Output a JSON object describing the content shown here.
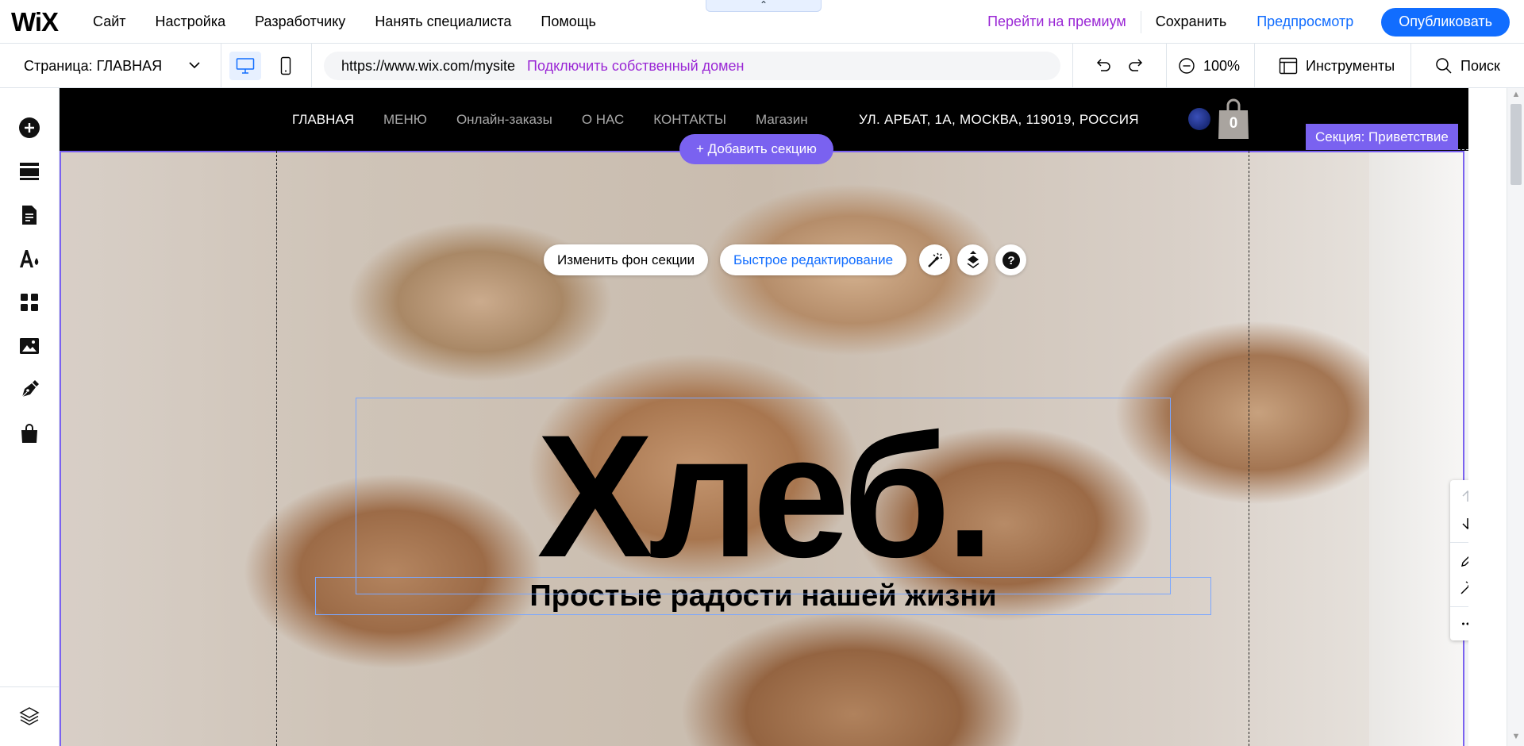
{
  "app": {
    "logo": "WiX",
    "menu": [
      "Сайт",
      "Настройка",
      "Разработчику",
      "Нанять специалиста",
      "Помощь"
    ],
    "collapse_icon": "caret-up-icon",
    "premium": "Перейти на премиум",
    "save": "Сохранить",
    "preview": "Предпросмотр",
    "publish": "Опубликовать"
  },
  "toolbar": {
    "page_selector": "Страница: ГЛАВНАЯ",
    "url": "https://www.wix.com/mysite",
    "connect_domain": "Подключить собственный домен",
    "zoom": "100%",
    "tools": "Инструменты",
    "search": "Поиск"
  },
  "sidebar": {
    "icons": [
      "add-icon",
      "sections-icon",
      "pages-icon",
      "design-icon",
      "apps-icon",
      "media-icon",
      "blog-icon",
      "store-icon",
      "layers-icon"
    ]
  },
  "site": {
    "nav": [
      "ГЛАВНАЯ",
      "МЕНЮ",
      "Онлайн-заказы",
      "О НАС",
      "КОНТАКТЫ",
      "Магазин"
    ],
    "address": "УЛ. АРБАТ, 1А, МОСКВА, 119019, РОССИЯ",
    "cart_count": "0",
    "hero_title": "Хлеб.",
    "hero_subtitle": "Простые радости нашей жизни"
  },
  "editor": {
    "add_section": "+ Добавить секцию",
    "section_label": "Секция: Приветствие",
    "change_background": "Изменить фон секции",
    "quick_edit": "Быстрое редактирование"
  },
  "colors": {
    "accent": "#116dff",
    "section_purple": "#7a62f0",
    "premium_purple": "#9a27d5"
  }
}
